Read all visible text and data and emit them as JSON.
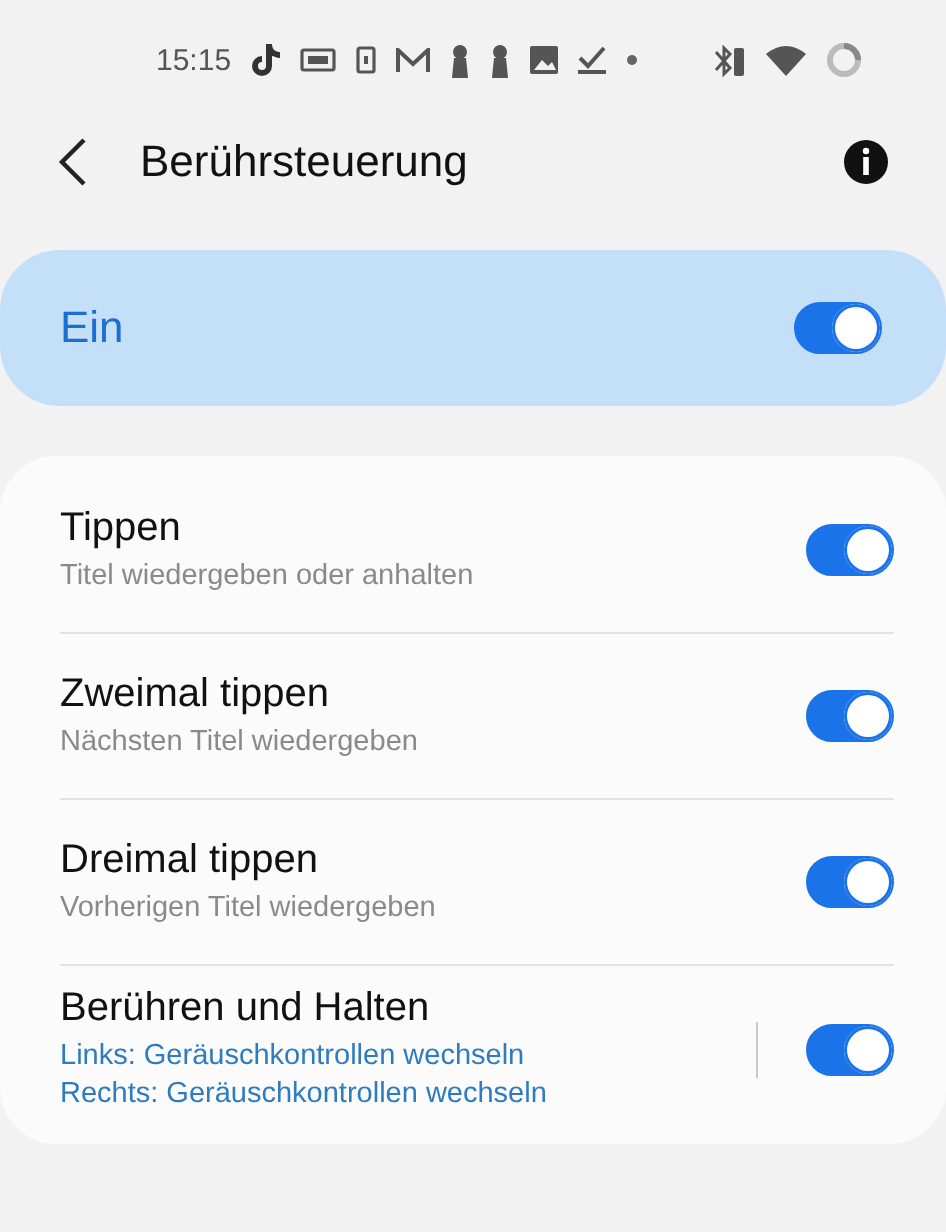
{
  "status_bar": {
    "time": "15:15"
  },
  "header": {
    "title": "Berührsteuerung"
  },
  "master": {
    "label": "Ein",
    "on": true
  },
  "items": [
    {
      "kind": "plain",
      "title": "Tippen",
      "subtitles": [
        "Titel wiedergeben oder anhalten"
      ],
      "on": true
    },
    {
      "kind": "plain",
      "title": "Zweimal tippen",
      "subtitles": [
        "Nächsten Titel wiedergeben"
      ],
      "on": true
    },
    {
      "kind": "plain",
      "title": "Dreimal tippen",
      "subtitles": [
        "Vorherigen Titel wiedergeben"
      ],
      "on": true
    },
    {
      "kind": "detail",
      "title": "Berühren und Halten",
      "subtitles": [
        "Links: Geräuschkontrollen wechseln",
        "Rechts: Geräuschkontrollen wechseln"
      ],
      "on": true
    }
  ]
}
